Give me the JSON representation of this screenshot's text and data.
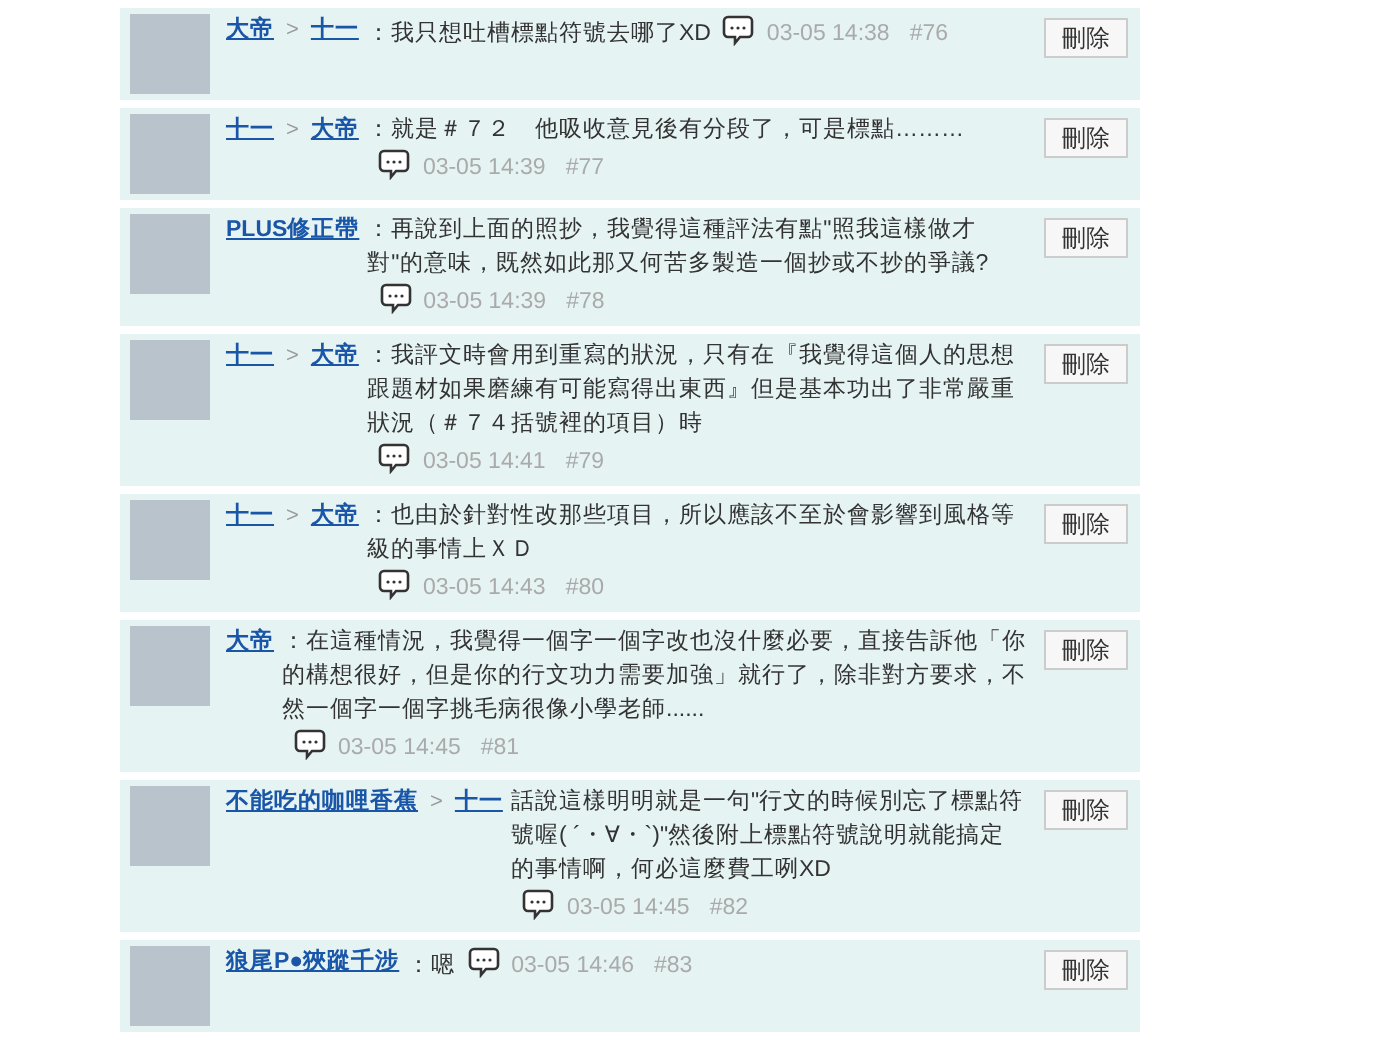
{
  "comments": [
    {
      "author": "大帝",
      "reply_to": "十一",
      "arrow": ">",
      "text": "：我只想吐槽標點符號去哪了XD",
      "time": "03-05 14:38",
      "floor": "#76",
      "delete": "刪除"
    },
    {
      "author": "十一",
      "reply_to": "大帝",
      "arrow": ">",
      "text": "：就是＃７２　他吸收意見後有分段了，可是標點………",
      "time": "03-05 14:39",
      "floor": "#77",
      "delete": "刪除"
    },
    {
      "author": "PLUS修正帶",
      "text": "：再說到上面的照抄，我覺得這種評法有點\"照我這樣做才對\"的意味，既然如此那又何苦多製造一個抄或不抄的爭議?",
      "time": "03-05 14:39",
      "floor": "#78",
      "delete": "刪除"
    },
    {
      "author": "十一",
      "reply_to": "大帝",
      "arrow": ">",
      "text": "：我評文時會用到重寫的狀況，只有在『我覺得這個人的思想跟題材如果磨練有可能寫得出東西』但是基本功出了非常嚴重狀況（＃７４括號裡的項目）時",
      "time": "03-05 14:41",
      "floor": "#79",
      "delete": "刪除"
    },
    {
      "author": "十一",
      "reply_to": "大帝",
      "arrow": ">",
      "text": "：也由於針對性改那些項目，所以應該不至於會影響到風格等級的事情上ＸＤ",
      "time": "03-05 14:43",
      "floor": "#80",
      "delete": "刪除"
    },
    {
      "author": "大帝",
      "text": "：在這種情況，我覺得一個字一個字改也沒什麼必要，直接告訴他「你的構想很好，但是你的行文功力需要加強」就行了，除非對方要求，不然一個字一個字挑毛病很像小學老師......",
      "time": "03-05 14:45",
      "floor": "#81",
      "delete": "刪除"
    },
    {
      "author": "不能吃的咖哩香蕉",
      "reply_to": "十一",
      "arrow": ">",
      "text": "話說這樣明明就是一句\"行文的時候別忘了標點符號喔( ´・∀・`)\"然後附上標點符號說明就能搞定的事情啊，何必這麼費工咧XD",
      "time": "03-05 14:45",
      "floor": "#82",
      "delete": "刪除"
    },
    {
      "author": "狼尾P●狹蹤千涉",
      "text": "：嗯",
      "time": "03-05 14:46",
      "floor": "#83",
      "delete": "刪除"
    }
  ]
}
